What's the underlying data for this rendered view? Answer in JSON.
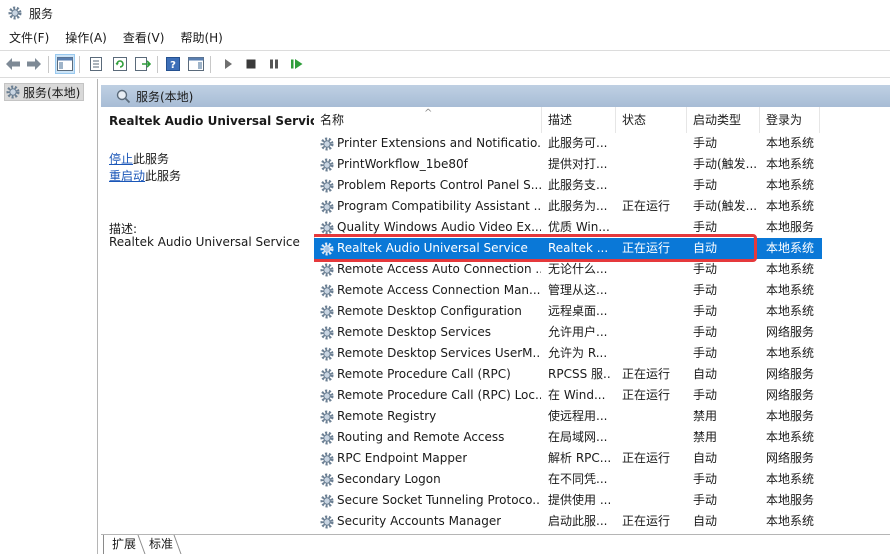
{
  "window": {
    "title": "服务"
  },
  "menu": [
    "文件(F)",
    "操作(A)",
    "查看(V)",
    "帮助(H)"
  ],
  "toolbar": {
    "buttons": [
      "back-icon",
      "forward-icon",
      "show-console-tree-icon",
      "properties-icon",
      "refresh-icon",
      "export-list-icon",
      "help-icon",
      "show-hide-action-pane-icon",
      "start-service-icon",
      "stop-service-icon",
      "pause-service-icon",
      "restart-service-icon"
    ]
  },
  "tree": {
    "root": "服务(本地)"
  },
  "content_header": "服务(本地)",
  "description_pane": {
    "service_name": "Realtek Audio Universal Service",
    "stop_link": "停止",
    "stop_suffix": "此服务",
    "restart_link": "重启动",
    "restart_suffix": "此服务",
    "desc_label": "描述:",
    "desc_text": "Realtek Audio Universal Service"
  },
  "columns": [
    "名称",
    "描述",
    "状态",
    "启动类型",
    "登录为"
  ],
  "rows": [
    {
      "name": "Printer Extensions and Notificatio...",
      "desc": "此服务可...",
      "status": "",
      "start": "手动",
      "logon": "本地系统"
    },
    {
      "name": "PrintWorkflow_1be80f",
      "desc": "提供对打...",
      "status": "",
      "start": "手动(触发...",
      "logon": "本地系统"
    },
    {
      "name": "Problem Reports Control Panel S...",
      "desc": "此服务支...",
      "status": "",
      "start": "手动",
      "logon": "本地系统"
    },
    {
      "name": "Program Compatibility Assistant ...",
      "desc": "此服务为...",
      "status": "正在运行",
      "start": "手动(触发...",
      "logon": "本地系统"
    },
    {
      "name": "Quality Windows Audio Video Ex...",
      "desc": "优质 Win...",
      "status": "",
      "start": "手动",
      "logon": "本地服务"
    },
    {
      "name": "Realtek Audio Universal Service",
      "desc": "Realtek ...",
      "status": "正在运行",
      "start": "自动",
      "logon": "本地系统"
    },
    {
      "name": "Remote Access Auto Connection ...",
      "desc": "无论什么...",
      "status": "",
      "start": "手动",
      "logon": "本地系统"
    },
    {
      "name": "Remote Access Connection Man...",
      "desc": "管理从这...",
      "status": "",
      "start": "手动",
      "logon": "本地系统"
    },
    {
      "name": "Remote Desktop Configuration",
      "desc": "远程桌面...",
      "status": "",
      "start": "手动",
      "logon": "本地系统"
    },
    {
      "name": "Remote Desktop Services",
      "desc": "允许用户...",
      "status": "",
      "start": "手动",
      "logon": "网络服务"
    },
    {
      "name": "Remote Desktop Services UserM...",
      "desc": "允许为 R...",
      "status": "",
      "start": "手动",
      "logon": "本地系统"
    },
    {
      "name": "Remote Procedure Call (RPC)",
      "desc": "RPCSS 服...",
      "status": "正在运行",
      "start": "自动",
      "logon": "网络服务"
    },
    {
      "name": "Remote Procedure Call (RPC) Loc...",
      "desc": "在 Wind...",
      "status": "正在运行",
      "start": "手动",
      "logon": "网络服务"
    },
    {
      "name": "Remote Registry",
      "desc": "使远程用...",
      "status": "",
      "start": "禁用",
      "logon": "本地服务"
    },
    {
      "name": "Routing and Remote Access",
      "desc": "在局域网...",
      "status": "",
      "start": "禁用",
      "logon": "本地系统"
    },
    {
      "name": "RPC Endpoint Mapper",
      "desc": "解析 RPC...",
      "status": "正在运行",
      "start": "自动",
      "logon": "网络服务"
    },
    {
      "name": "Secondary Logon",
      "desc": "在不同凭...",
      "status": "",
      "start": "手动",
      "logon": "本地系统"
    },
    {
      "name": "Secure Socket Tunneling Protoco...",
      "desc": "提供使用 ...",
      "status": "",
      "start": "手动",
      "logon": "本地服务"
    },
    {
      "name": "Security Accounts Manager",
      "desc": "启动此服...",
      "status": "正在运行",
      "start": "自动",
      "logon": "本地系统"
    }
  ],
  "selected_row": "Realtek Audio Universal Service",
  "tabs": [
    "扩展",
    "标准"
  ],
  "colors": {
    "selection": "#0a78d7",
    "highlight_box": "#e5393c",
    "link": "#1a56b8",
    "header_band": "#b3c6dc"
  }
}
